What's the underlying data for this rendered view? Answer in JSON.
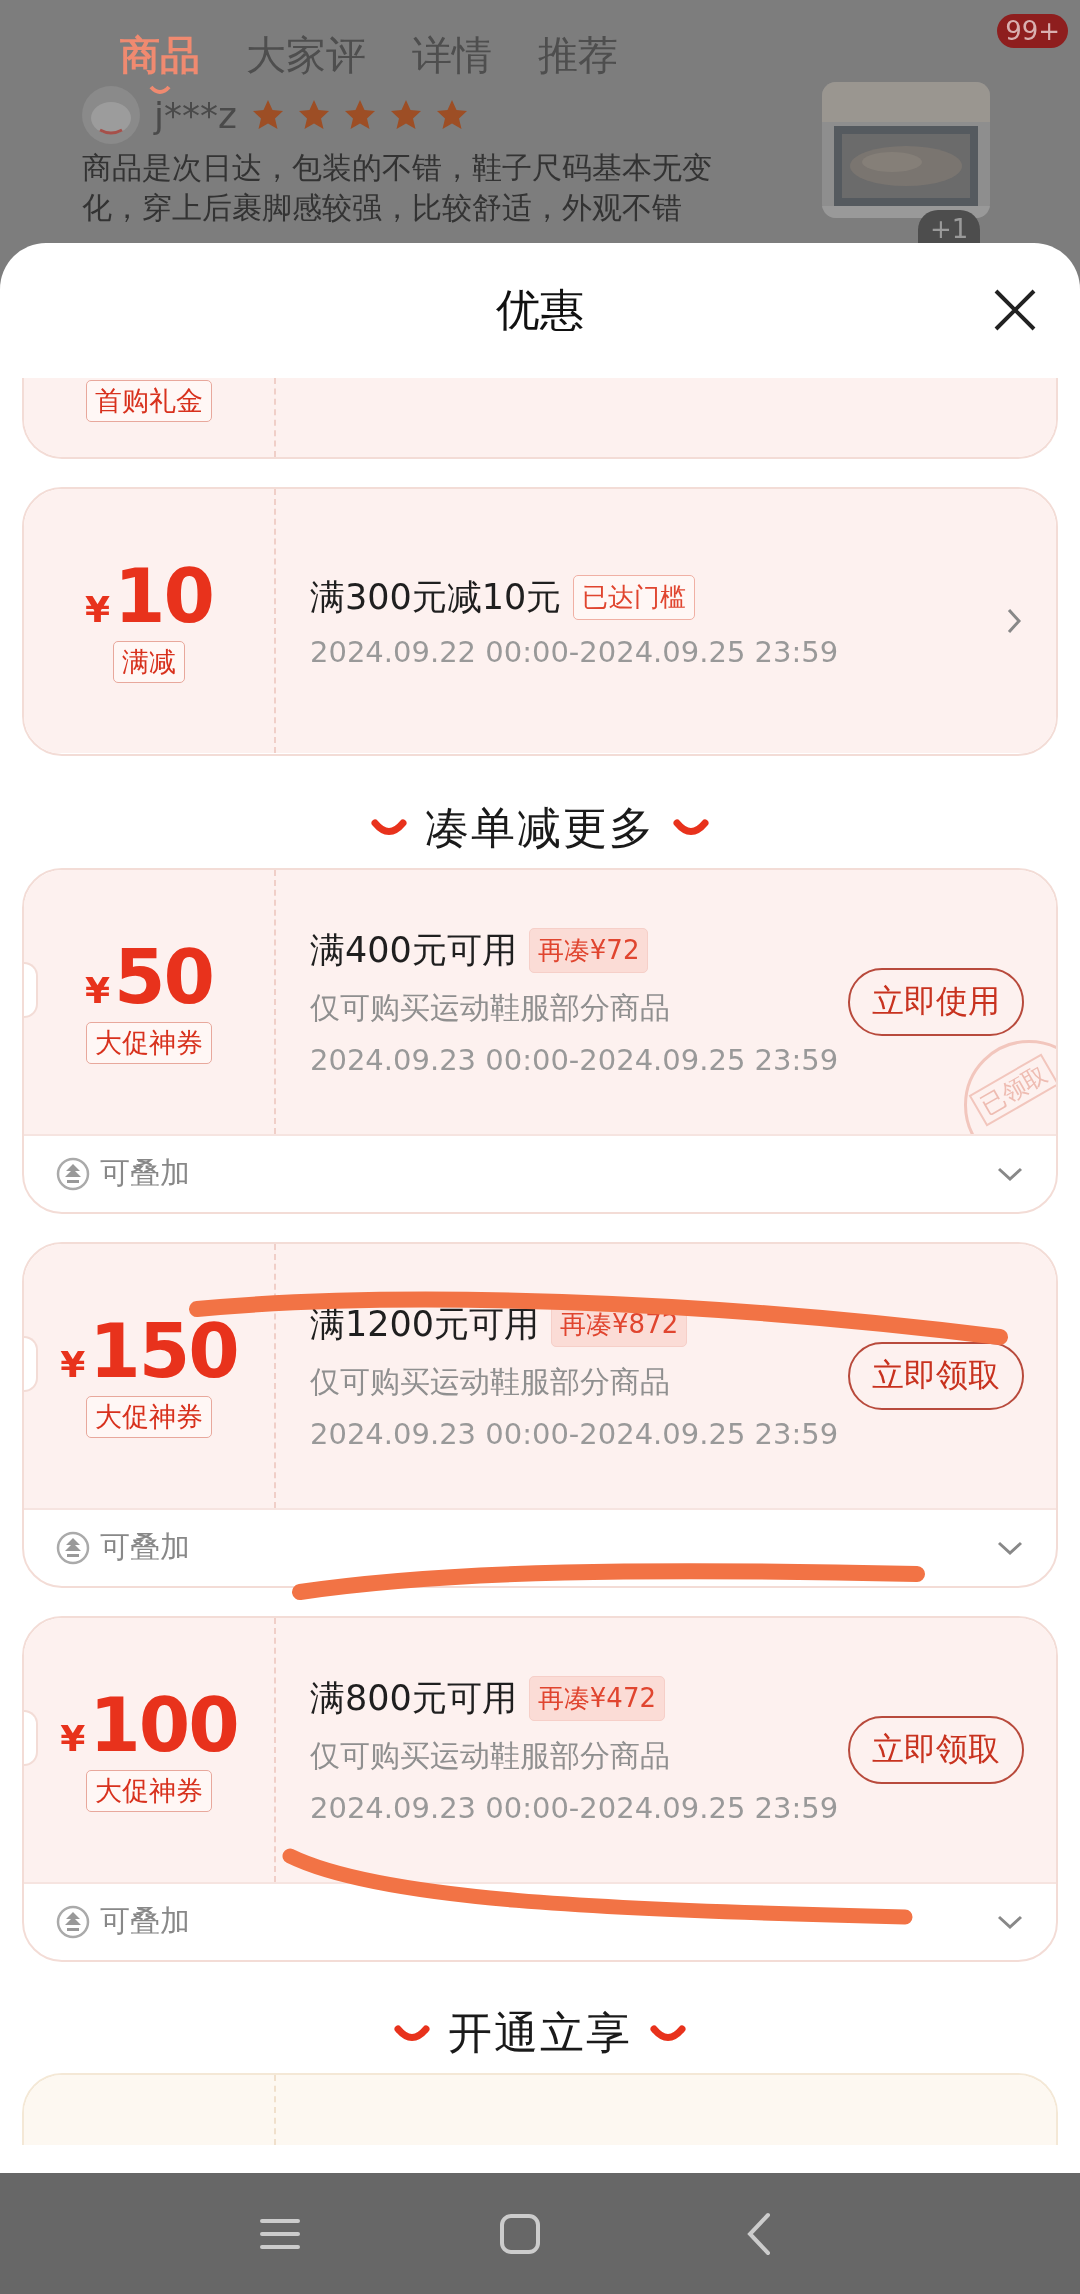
{
  "background": {
    "tabs": [
      {
        "label": "商品",
        "selected": true
      },
      {
        "label": "大家评",
        "selected": false
      },
      {
        "label": "详情",
        "selected": false
      },
      {
        "label": "推荐",
        "selected": false
      }
    ],
    "badge": "99+",
    "review": {
      "user": "j***z",
      "stars": 5,
      "lines": [
        "商品是次日达，包装的不错，鞋子尺码基本无变",
        "化，穿上后裹脚感较强，比较舒适，外观不错"
      ],
      "photo_count": "+1"
    }
  },
  "sheet": {
    "title": "优惠"
  },
  "items": [
    {
      "kind": "stub_top",
      "tag": "首购礼金"
    },
    {
      "kind": "coupon",
      "currency": "¥",
      "amount": "10",
      "tag": "满减",
      "title": "满300元减10元",
      "badge": "已达门槛",
      "threshold_met": true,
      "validity": "2024.09.22 00:00-2024.09.25 23:59"
    },
    {
      "kind": "heading",
      "text": "凑单减更多"
    },
    {
      "kind": "coupon",
      "currency": "¥",
      "amount": "50",
      "tag": "大促神券",
      "title": "满400元可用",
      "badge": "再凑¥72",
      "threshold_met": false,
      "scope": "仅可购买运动鞋服部分商品",
      "validity": "2024.09.23 00:00-2024.09.25 23:59",
      "action": "立即使用",
      "stamp": "已领取",
      "stack": "可叠加"
    },
    {
      "kind": "coupon",
      "currency": "¥",
      "amount": "150",
      "tag": "大促神券",
      "title": "满1200元可用",
      "badge": "再凑¥872",
      "threshold_met": false,
      "scope": "仅可购买运动鞋服部分商品",
      "validity": "2024.09.23 00:00-2024.09.25 23:59",
      "action": "立即领取",
      "stack": "可叠加"
    },
    {
      "kind": "coupon",
      "currency": "¥",
      "amount": "100",
      "tag": "大促神券",
      "title": "满800元可用",
      "badge": "再凑¥472",
      "threshold_met": false,
      "scope": "仅可购买运动鞋服部分商品",
      "validity": "2024.09.23 00:00-2024.09.25 23:59",
      "action": "立即领取",
      "stack": "可叠加"
    },
    {
      "kind": "heading",
      "text": "开通立享"
    },
    {
      "kind": "stub_bottom"
    }
  ]
}
